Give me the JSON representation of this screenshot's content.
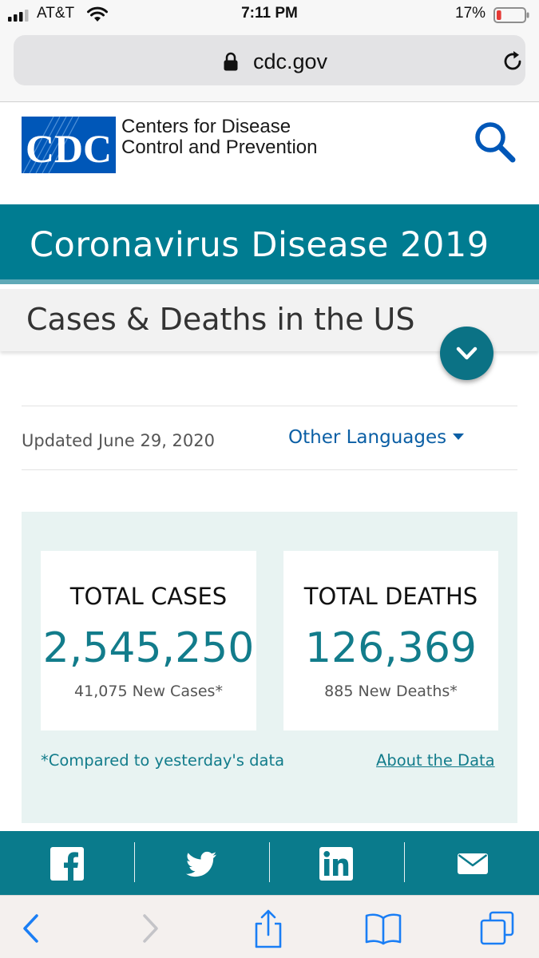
{
  "status_bar": {
    "carrier": "AT&T",
    "time": "7:11 PM",
    "battery_percent": "17%",
    "battery_level": 0.17,
    "battery_color": "#e53935"
  },
  "browser": {
    "url": "cdc.gov",
    "icons": [
      "lock-icon",
      "reload-icon"
    ]
  },
  "header": {
    "logo_text": "CDC",
    "org_name_line1": "Centers for Disease",
    "org_name_line2": "Control and Prevention",
    "icons": [
      "search-icon"
    ]
  },
  "page": {
    "title": "Coronavirus Disease 2019",
    "subtitle": "Cases & Deaths in the US",
    "updated": "Updated June 29, 2020",
    "languages_link": "Other Languages"
  },
  "stats": {
    "total_cases_label": "TOTAL CASES",
    "total_cases_value": "2,545,250",
    "new_cases": "41,075 New Cases*",
    "total_deaths_label": "TOTAL DEATHS",
    "total_deaths_value": "126,369",
    "new_deaths": "885 New Deaths*",
    "footnote": "*Compared to yesterday's data",
    "about_link": "About the Data"
  },
  "social": {
    "icons": [
      "facebook-icon",
      "twitter-icon",
      "linkedin-icon",
      "email-icon"
    ]
  },
  "toolbar": {
    "icons": [
      "back-icon",
      "forward-icon",
      "share-icon",
      "bookmarks-icon",
      "tabs-icon"
    ]
  },
  "colors": {
    "teal": "#007c91",
    "stat_value": "#127c8b",
    "link_blue": "#0b5fa5",
    "cdc_blue": "#0057b8",
    "ios_blue": "#1a7ef5"
  }
}
